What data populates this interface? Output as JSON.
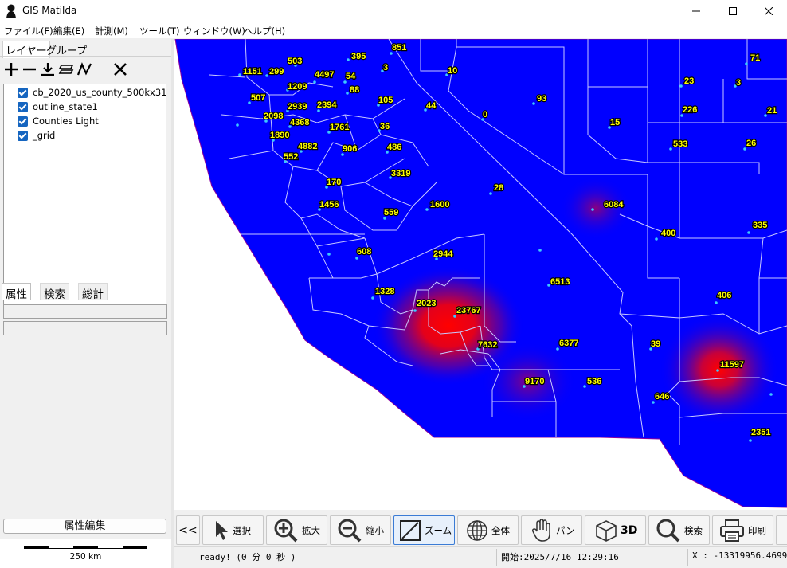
{
  "window": {
    "title": "GIS Matilda"
  },
  "menu": [
    "ファイル(F)",
    "編集(E)",
    "計測(M)",
    "ツール(T)",
    "ウィンドウ(W)",
    "ヘルプ(H)"
  ],
  "left_panel": {
    "tabs": [
      "レイヤー",
      "グループ"
    ],
    "toolbar_icons": [
      "add-layer-icon",
      "remove-layer-icon",
      "import-icon",
      "layer-style-icon",
      "line-icon",
      "close-icon"
    ],
    "layers": [
      {
        "name": "cb_2020_us_county_500kx3142a_",
        "checked": true
      },
      {
        "name": "outline_state1",
        "checked": true
      },
      {
        "name": "Counties Light",
        "checked": true
      },
      {
        "name": "_grid",
        "checked": true
      }
    ],
    "attr_tabs": [
      "属性",
      "検索",
      "総計"
    ],
    "attr_edit_label": "属性編集",
    "scale_label": "250 km"
  },
  "map": {
    "fill_color": "#0000ff",
    "hotspot_color": "#ff0000",
    "label_color": "#ffff00",
    "boundary_color": "#c8c8ff",
    "labels": [
      "1151",
      "299",
      "503",
      "395",
      "851",
      "3",
      "10",
      "4497",
      "54",
      "1209",
      "88",
      "507",
      "2939",
      "2394",
      "105",
      "44",
      "0",
      "93",
      "2098",
      "4368",
      "1761",
      "36",
      "1890",
      "486",
      "4882",
      "906",
      "552",
      "3319",
      "170",
      "1600",
      "28",
      "1456",
      "559",
      "608",
      "2944",
      "1328",
      "2023",
      "23767",
      "7632",
      "6377",
      "9170",
      "536",
      "6513",
      "6084",
      "400",
      "15",
      "71",
      "23",
      "226",
      "21",
      "533",
      "26",
      "335",
      "406",
      "39",
      "11597",
      "646",
      "2351",
      "3"
    ]
  },
  "toolbar": {
    "collapse_label": "<<",
    "buttons": [
      {
        "name": "select",
        "label": "選択",
        "icon": "pointer-icon"
      },
      {
        "name": "zoom-in",
        "label": "拡大",
        "icon": "zoom-in-icon"
      },
      {
        "name": "zoom-out",
        "label": "縮小",
        "icon": "zoom-out-icon"
      },
      {
        "name": "zoom",
        "label": "ズーム",
        "icon": "zoom-box-icon"
      },
      {
        "name": "full-extent",
        "label": "全体",
        "icon": "globe-icon"
      },
      {
        "name": "pan",
        "label": "パン",
        "icon": "hand-icon"
      },
      {
        "name": "3d",
        "label": "3D",
        "icon": "cube-icon"
      },
      {
        "name": "search",
        "label": "検索",
        "icon": "search-icon"
      },
      {
        "name": "print",
        "label": "印刷",
        "icon": "printer-icon"
      }
    ]
  },
  "status": {
    "message": "ready! (0 分 0 秒 )",
    "start": "開始:2025/7/16 12:29:16",
    "coords": "X : -13319956.4699"
  }
}
